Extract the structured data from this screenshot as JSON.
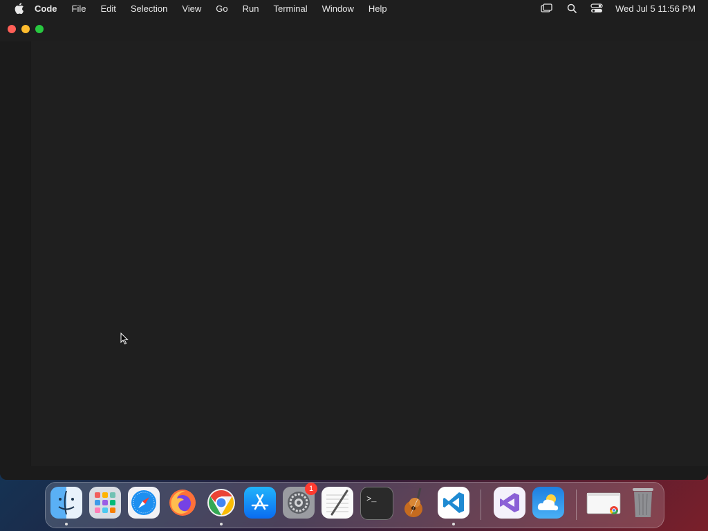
{
  "menubar": {
    "app_name": "Code",
    "items": [
      "File",
      "Edit",
      "Selection",
      "View",
      "Go",
      "Run",
      "Terminal",
      "Window",
      "Help"
    ],
    "icons": [
      "apple-icon",
      "screen-mirroring-icon",
      "spotlight-search-icon",
      "control-center-icon"
    ],
    "clock": "Wed Jul 5  11:56 PM"
  },
  "window": {
    "title": "",
    "traffic_lights": [
      "close",
      "minimize",
      "maximize"
    ],
    "colors": {
      "close": "#ff5f57",
      "minimize": "#febc2e",
      "maximize": "#28c840",
      "background": "#1f1f1f"
    }
  },
  "dock": {
    "apps": [
      {
        "name": "finder-icon",
        "running": true
      },
      {
        "name": "launchpad-icon",
        "running": false
      },
      {
        "name": "safari-icon",
        "running": false
      },
      {
        "name": "firefox-icon",
        "running": false
      },
      {
        "name": "chrome-icon",
        "running": true
      },
      {
        "name": "app-store-icon",
        "running": false
      },
      {
        "name": "system-settings-icon",
        "running": false,
        "badge": "1"
      },
      {
        "name": "textedit-icon",
        "running": false
      },
      {
        "name": "terminal-icon",
        "running": false
      },
      {
        "name": "garageband-icon",
        "running": false
      },
      {
        "name": "vscode-icon",
        "running": true
      },
      {
        "name": "visual-studio-icon",
        "running": false
      },
      {
        "name": "weather-icon",
        "running": false
      },
      {
        "name": "chrome-window-icon",
        "running": false
      },
      {
        "name": "trash-icon",
        "running": false
      }
    ]
  }
}
